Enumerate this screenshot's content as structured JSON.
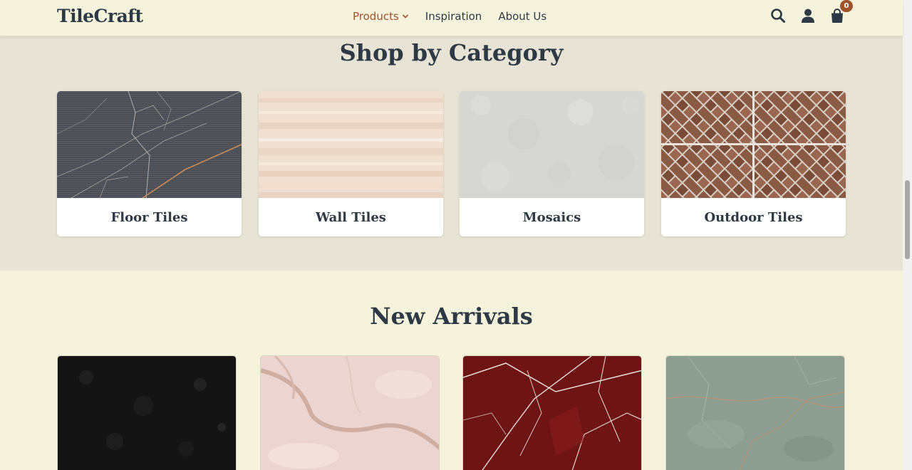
{
  "header": {
    "logo": "TileCraft",
    "nav": [
      {
        "label": "Products",
        "active": true
      },
      {
        "label": "Inspiration",
        "active": false
      },
      {
        "label": "About Us",
        "active": false
      }
    ],
    "cart_count": "0",
    "accent_color": "#a0522d"
  },
  "categories": {
    "title": "Shop by Category",
    "items": [
      {
        "label": "Floor Tiles",
        "image": "dark-grey-marble"
      },
      {
        "label": "Wall Tiles",
        "image": "beige-travertine"
      },
      {
        "label": "Mosaics",
        "image": "light-grey-stone"
      },
      {
        "label": "Outdoor Tiles",
        "image": "brick-herringbone"
      }
    ]
  },
  "new_arrivals": {
    "title": "New Arrivals",
    "items": [
      {
        "image": "black-granite"
      },
      {
        "image": "pink-marble"
      },
      {
        "image": "red-marble"
      },
      {
        "image": "green-marble"
      }
    ]
  }
}
